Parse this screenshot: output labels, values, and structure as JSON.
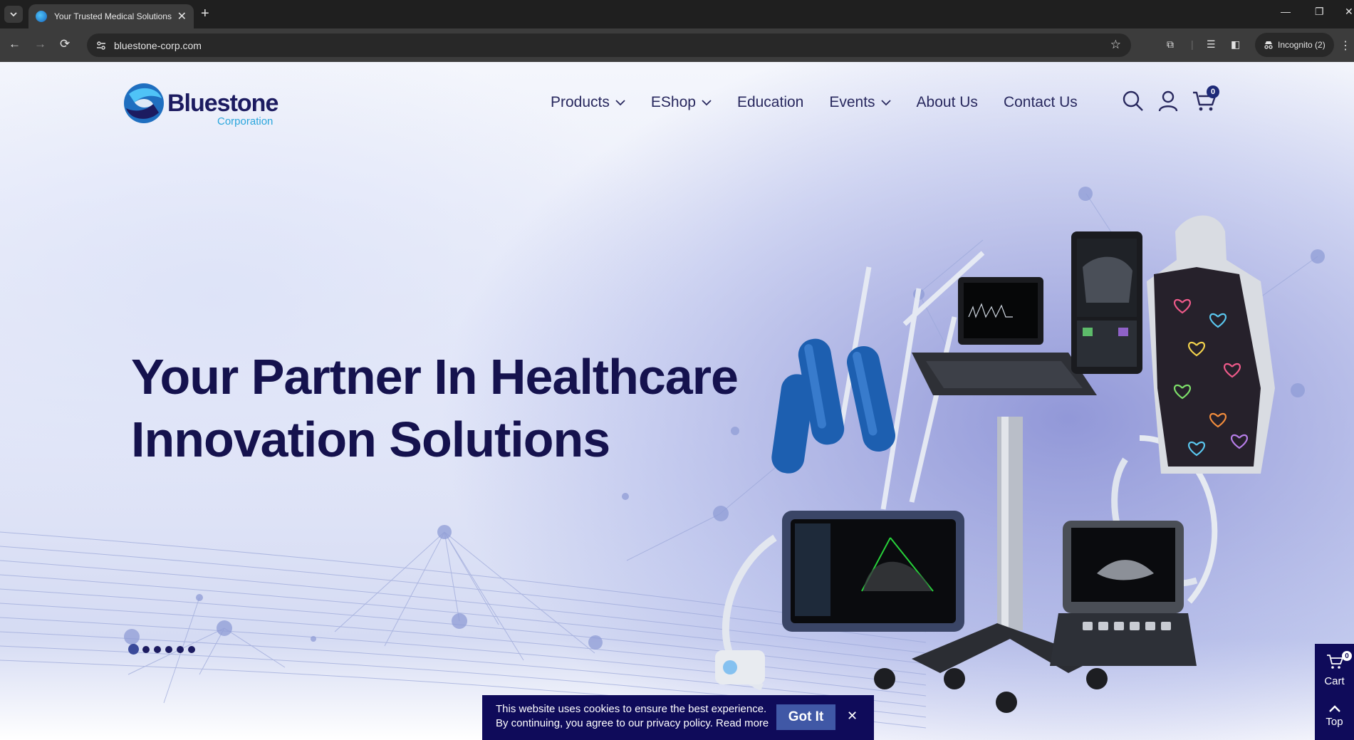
{
  "browser": {
    "tab_title": "Your Trusted Medical Solutions",
    "url": "bluestone-corp.com",
    "incognito_label": "Incognito (2)"
  },
  "brand": {
    "name": "Bluestone",
    "sub": "Corporation"
  },
  "nav": {
    "items": [
      {
        "label": "Products",
        "dropdown": true
      },
      {
        "label": "EShop",
        "dropdown": true
      },
      {
        "label": "Education",
        "dropdown": false
      },
      {
        "label": "Events",
        "dropdown": true
      },
      {
        "label": "About Us",
        "dropdown": false
      },
      {
        "label": "Contact Us",
        "dropdown": false
      }
    ],
    "cart_count": "0"
  },
  "hero": {
    "line1": "Your Partner In Healthcare",
    "line2": "Innovation Solutions",
    "slide_count": 6,
    "active_slide": 1
  },
  "cookie": {
    "line1": "This website uses cookies to ensure the best experience.",
    "line2": "By continuing, you agree to our privacy policy. Read more",
    "button": "Got It"
  },
  "side": {
    "cart_label": "Cart",
    "cart_count": "0",
    "top_label": "Top"
  },
  "colors": {
    "brand_navy": "#1c1b60",
    "brand_cyan": "#2aa6dc",
    "cookie_bg": "#0f0b5a",
    "button_blue": "#4058a6"
  },
  "icons": [
    "search-icon",
    "user-icon",
    "cart-icon",
    "chevron-down-icon",
    "close-icon",
    "arrow-up-icon"
  ]
}
